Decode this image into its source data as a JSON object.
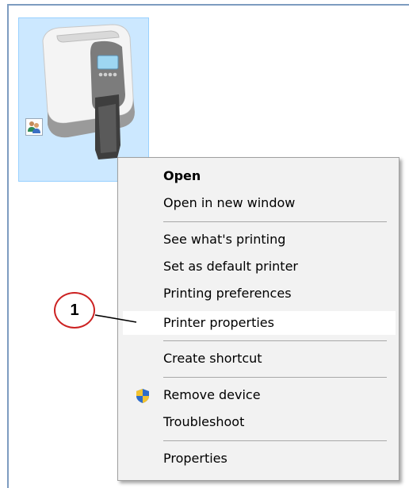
{
  "menu": {
    "items": [
      {
        "label": "Open"
      },
      {
        "label": "Open in new window"
      },
      {
        "label": "See what's printing"
      },
      {
        "label": "Set as default printer"
      },
      {
        "label": "Printing preferences"
      },
      {
        "label": "Printer properties"
      },
      {
        "label": "Create shortcut"
      },
      {
        "label": "Remove device",
        "icon": "uac-shield-icon"
      },
      {
        "label": "Troubleshoot"
      },
      {
        "label": "Properties"
      }
    ]
  },
  "callout": {
    "number": "1",
    "color": "#cc2222"
  },
  "colors": {
    "selection_bg": "#cce8ff",
    "menu_bg": "#f2f2f2",
    "highlight_bg": "#ffffff"
  },
  "icons": {
    "printer": "card-printer-icon",
    "shared": "shared-users-icon"
  }
}
